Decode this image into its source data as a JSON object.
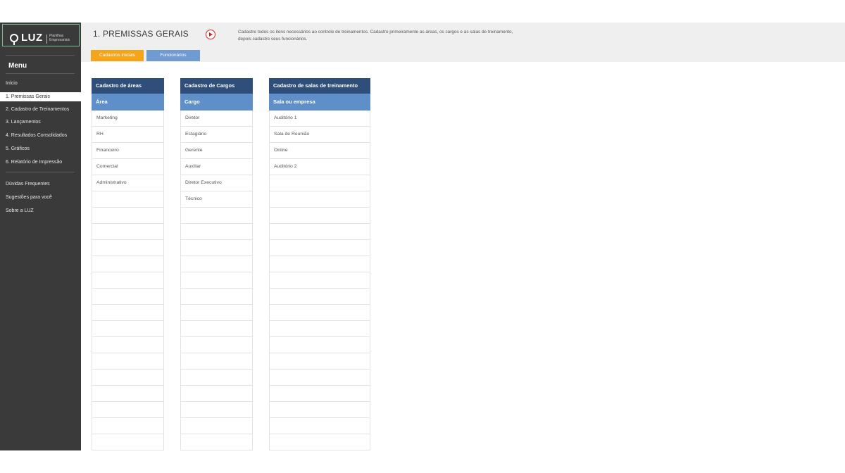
{
  "sidebar": {
    "logo_text": "LUZ",
    "logo_sub": "Planilhas Empresariais",
    "menu_title": "Menu",
    "items": [
      {
        "label": "Início"
      },
      {
        "label": "1. Premissas Gerais",
        "active": true
      },
      {
        "label": "2. Cadastro de Treinamentos"
      },
      {
        "label": "3. Lançamentos"
      },
      {
        "label": "4. Resultados Consolidados"
      },
      {
        "label": "5. Gráficos"
      },
      {
        "label": "6. Relatório de Impressão"
      }
    ],
    "extra_items": [
      {
        "label": "Dúvidas Frequentes"
      },
      {
        "label": "Sugestões para você"
      },
      {
        "label": "Sobre a LUZ"
      }
    ]
  },
  "header": {
    "title": "1. PREMISSAS GERAIS",
    "description": "Cadastre todos os itens necessários ao controle de treinamentos. Cadastre primeiramente as áreas, os cargos e as salas de treinamento, depois cadastre seus funcionários.",
    "tabs": [
      {
        "label": "Cadastros iniciais",
        "color": "#f4a51c"
      },
      {
        "label": "Funcionários",
        "color": "#6f9bd1"
      }
    ]
  },
  "tables": [
    {
      "title": "Cadastro de áreas",
      "column": "Área",
      "rows": [
        "Marketing",
        "RH",
        "Financeiro",
        "Comercial",
        "Administrativo",
        "",
        "",
        "",
        "",
        "",
        "",
        "",
        "",
        "",
        "",
        "",
        "",
        "",
        "",
        "",
        ""
      ]
    },
    {
      "title": "Cadastro de Cargos",
      "column": "Cargo",
      "rows": [
        "Diretor",
        "Estagiário",
        "Gerente",
        "Auxiliar",
        "Diretor Executivo",
        "Técnico",
        "",
        "",
        "",
        "",
        "",
        "",
        "",
        "",
        "",
        "",
        "",
        "",
        "",
        "",
        ""
      ]
    },
    {
      "title": "Cadastro de salas de treinamento",
      "column": "Sala ou empresa",
      "rows": [
        "Auditório 1",
        "Sala de Reunião",
        "Online",
        "Auditório 2",
        "",
        "",
        "",
        "",
        "",
        "",
        "",
        "",
        "",
        "",
        "",
        "",
        "",
        "",
        "",
        "",
        ""
      ]
    }
  ],
  "colors": {
    "sidebar_bg": "#3a3a3a",
    "table_title_bg": "#2f4f7a",
    "table_header_bg": "#5e8fc9",
    "accent_orange": "#f4a51c",
    "accent_blue": "#6f9bd1"
  },
  "icons": {
    "play": "play-icon",
    "logo": "lightbulb-logo-icon"
  }
}
